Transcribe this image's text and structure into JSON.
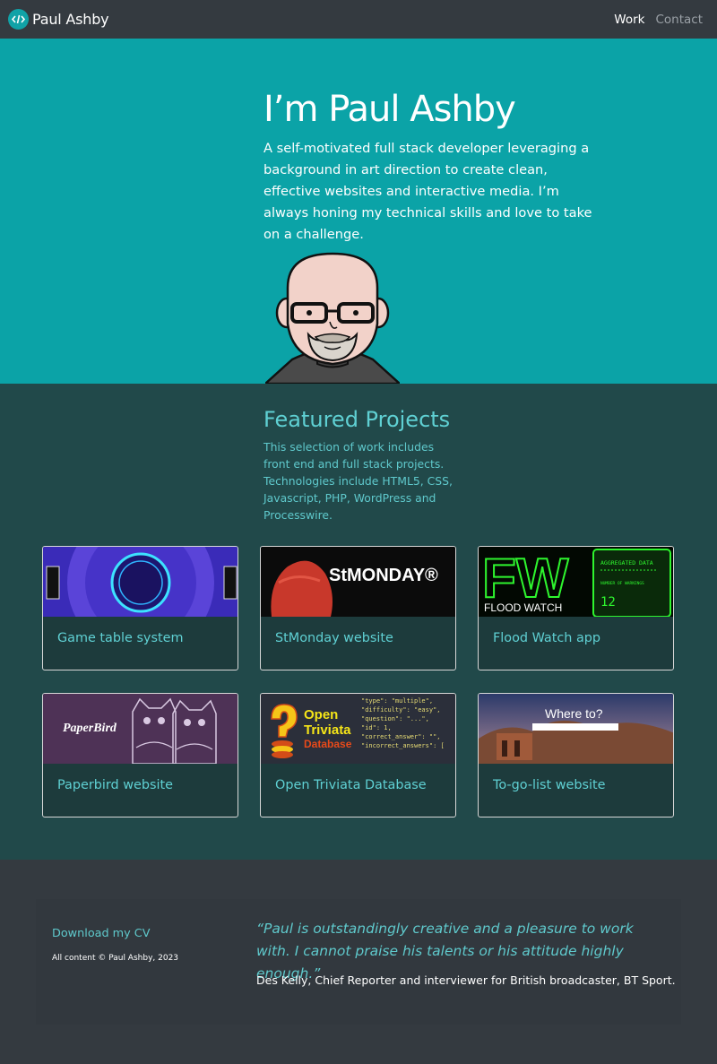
{
  "nav": {
    "brand": "Paul Ashby",
    "links": [
      {
        "label": "Work",
        "active": true
      },
      {
        "label": "Contact",
        "active": false
      }
    ]
  },
  "hero": {
    "title": "I’m Paul Ashby",
    "intro": "A self-motivated full stack developer leveraging a background in art direction to create clean, effective websites and interactive media. I’m always honing my technical skills and love to take on a challenge."
  },
  "projects": {
    "title": "Featured Projects",
    "description": "This selection of work includes front end and full stack projects. Technologies include HTML5, CSS, Javascript, PHP, WordPress and Processwire.",
    "cards": [
      {
        "title": "Game table system"
      },
      {
        "title": "StMonday website",
        "image_text": "StMONDAY®"
      },
      {
        "title": "Flood Watch app",
        "image_text": {
          "logo": "FW",
          "caption": "FLOOD WATCH",
          "panel_title": "AGGREGATED DATA",
          "panel_label": "NUMBER OF WARNINGS",
          "panel_value": "12"
        }
      },
      {
        "title": "Paperbird website",
        "image_text": "PaperBird"
      },
      {
        "title": "Open Triviata Database",
        "image_text": {
          "line1": "Open",
          "line2": "Triviata",
          "line3": "Database"
        }
      },
      {
        "title": "To-go-list website",
        "image_text": "Where to?"
      }
    ]
  },
  "footer": {
    "cv_link": "Download my CV",
    "copyright": "All content © Paul Ashby, 2023",
    "quote": "“Paul is outstandingly creative and a pleasure to work with. I cannot praise his talents or his attitude highly enough.”",
    "attribution": "Des Kelly, Chief Reporter and interviewer for British broadcaster, BT Sport."
  },
  "colors": {
    "hero_bg": "#0ba3a7",
    "projects_bg": "#21494a",
    "accent": "#5fd0d3",
    "dark": "#343a40"
  }
}
